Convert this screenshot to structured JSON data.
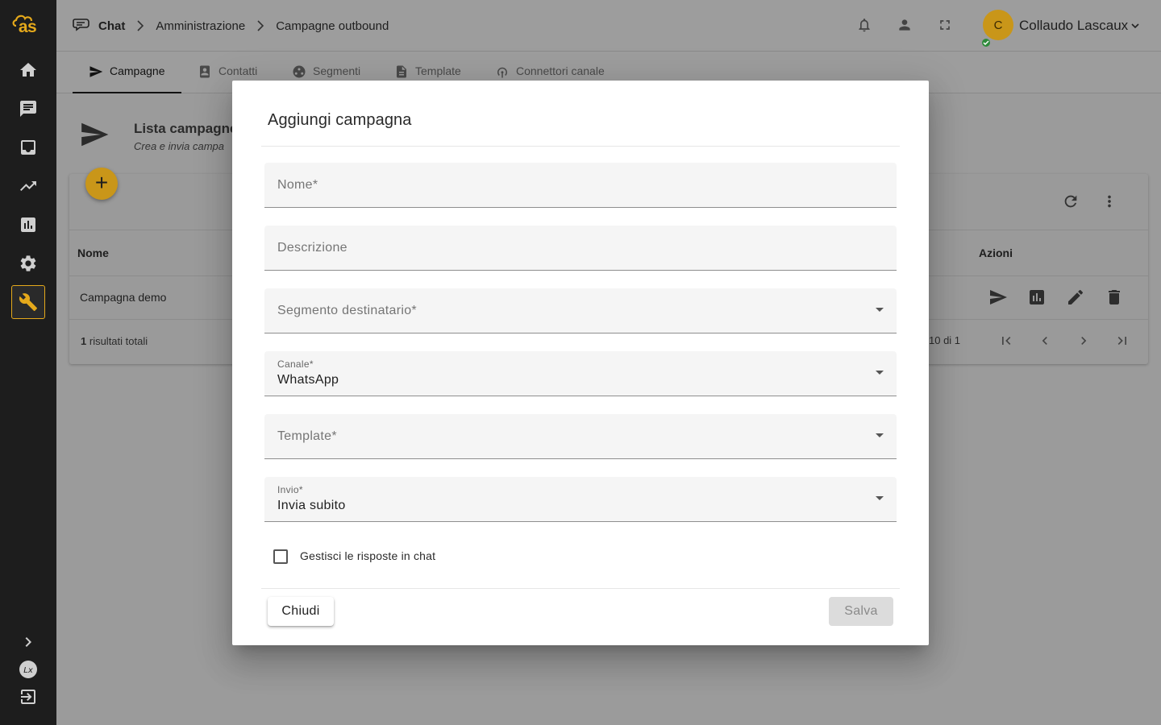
{
  "sidebar": {
    "logo_text": "as",
    "items": [
      {
        "name": "home-icon"
      },
      {
        "name": "chat-icon"
      },
      {
        "name": "inbox-icon"
      },
      {
        "name": "trending-icon"
      },
      {
        "name": "bar-chart-icon"
      },
      {
        "name": "settings-icon"
      },
      {
        "name": "wrench-icon",
        "active": true
      }
    ],
    "bottom": [
      {
        "name": "expand-icon"
      },
      {
        "name": "brand-circle-icon"
      },
      {
        "name": "logout-icon"
      }
    ]
  },
  "breadcrumb": {
    "items": [
      "Chat",
      "Amministrazione",
      "Campagne outbound"
    ]
  },
  "user": {
    "initial": "C",
    "name": "Collaudo Lascaux",
    "status_color": "#2e8b3b"
  },
  "tabs": [
    {
      "label": "Campagne",
      "icon": "send-icon",
      "active": true
    },
    {
      "label": "Contatti",
      "icon": "contacts-icon"
    },
    {
      "label": "Segmenti",
      "icon": "segments-icon"
    },
    {
      "label": "Template",
      "icon": "document-icon"
    },
    {
      "label": "Connettori canale",
      "icon": "antenna-icon"
    }
  ],
  "page": {
    "title": "Lista campagne",
    "subtitle": "Crea e invia campa"
  },
  "table": {
    "columns": {
      "name": "Nome",
      "actions": "Azioni"
    },
    "rows": [
      {
        "name": "Campagna demo"
      }
    ],
    "total_count": "1",
    "total_label": "risultati totali",
    "pagination_text": "10 di 1"
  },
  "modal": {
    "title": "Aggiungi campagna",
    "fields": {
      "name": {
        "placeholder": "Nome*"
      },
      "description": {
        "placeholder": "Descrizione"
      },
      "segment": {
        "placeholder": "Segmento destinatario*"
      },
      "channel": {
        "label": "Canale*",
        "value": "WhatsApp"
      },
      "template": {
        "placeholder": "Template*"
      },
      "send": {
        "label": "Invio*",
        "value": "Invia subito"
      }
    },
    "checkbox": {
      "label": "Gestisci le risposte in chat",
      "checked": false
    },
    "close_label": "Chiudi",
    "save_label": "Salva"
  },
  "colors": {
    "accent": "#e5a91b",
    "sidebar_bg": "#1d1d1d",
    "overlay": "#9b9b9b"
  }
}
